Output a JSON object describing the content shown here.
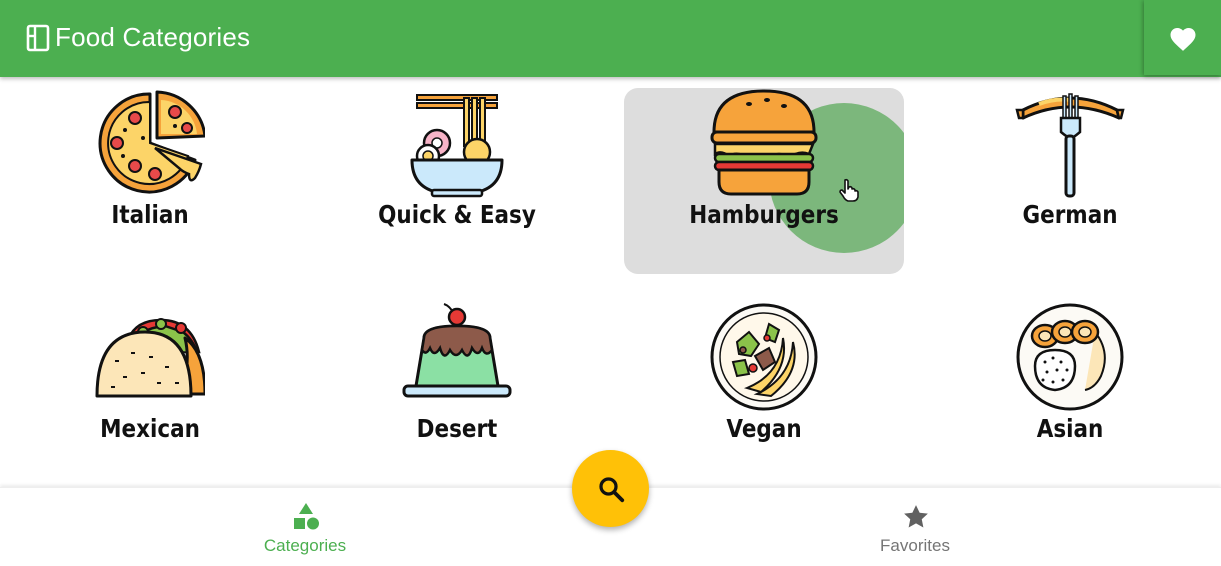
{
  "appbar": {
    "title": "Food Categories",
    "title_icon": "menu-book-icon",
    "favorite_icon": "heart-icon",
    "color": "#4caf50"
  },
  "categories": [
    {
      "label": "Italian",
      "icon": "pizza-icon"
    },
    {
      "label": "Quick & Easy",
      "icon": "noodle-bowl-icon"
    },
    {
      "label": "Hamburgers",
      "icon": "hamburger-icon",
      "state": "pressed"
    },
    {
      "label": "German",
      "icon": "sausage-fork-icon"
    },
    {
      "label": "Mexican",
      "icon": "taco-icon"
    },
    {
      "label": "Desert",
      "icon": "pudding-icon"
    },
    {
      "label": "Vegan",
      "icon": "salad-plate-icon"
    },
    {
      "label": "Asian",
      "icon": "rice-plate-icon"
    }
  ],
  "bottom_nav": {
    "items": [
      {
        "label": "Categories",
        "icon": "category-shapes-icon",
        "active": true,
        "color": "#4caf50"
      },
      {
        "label": "Favorites",
        "icon": "star-icon",
        "active": false,
        "color": "#757575"
      }
    ],
    "fab": {
      "icon": "search-icon",
      "color": "#ffc107"
    }
  }
}
